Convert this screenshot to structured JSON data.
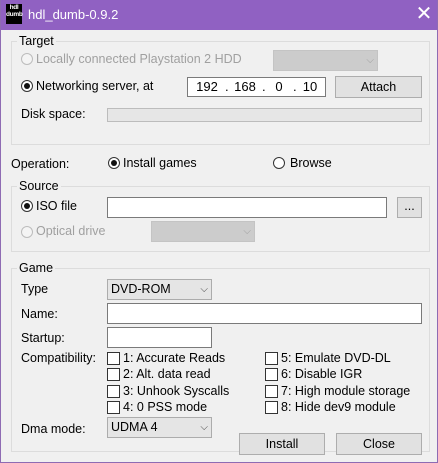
{
  "window": {
    "title": "hdl_dumb-0.9.2",
    "icon_lines": [
      "hdl",
      "dumb"
    ],
    "close_glyph": "✕",
    "title_color": "#9061c2"
  },
  "target": {
    "group_label": "Target",
    "local_hdd_label": "Locally connected Playstation 2 HDD",
    "local_hdd_selected": false,
    "network_label": "Networking server, at",
    "network_selected": true,
    "ip": [
      "192",
      "168",
      "0",
      "10"
    ],
    "attach_label": "Attach",
    "disk_space_label": "Disk space:",
    "disk_space_fill": 0
  },
  "operation": {
    "label": "Operation:",
    "install_label": "Install games",
    "install_selected": true,
    "browse_label": "Browse",
    "browse_selected": false
  },
  "source": {
    "group_label": "Source",
    "iso_label": "ISO file",
    "iso_selected": true,
    "iso_path": "",
    "browse_button_label": "...",
    "optical_label": "Optical drive",
    "optical_selected": false
  },
  "game": {
    "group_label": "Game",
    "type_label": "Type",
    "type_value": "DVD-ROM",
    "name_label": "Name:",
    "name_value": "",
    "startup_label": "Startup:",
    "startup_value": "",
    "compat_label": "Compatibility:",
    "compat_left": [
      "1: Accurate Reads",
      "2: Alt. data read",
      "3: Unhook Syscalls",
      "4: 0 PSS mode"
    ],
    "compat_right": [
      "5: Emulate DVD-DL",
      "6: Disable IGR",
      "7: High module storage",
      "8: Hide dev9 module"
    ],
    "dma_label": "Dma mode:",
    "dma_value": "UDMA 4"
  },
  "buttons": {
    "install": "Install",
    "close": "Close"
  }
}
